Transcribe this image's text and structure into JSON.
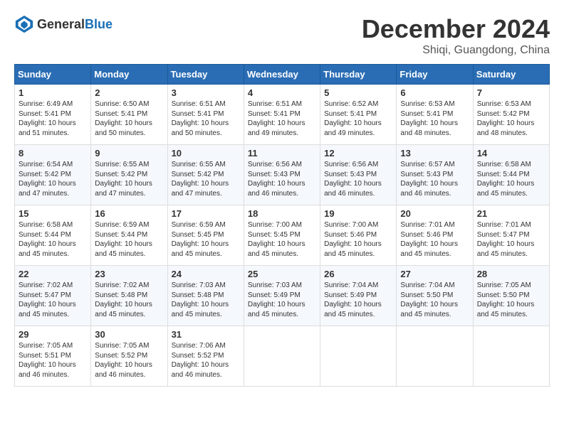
{
  "logo": {
    "text_general": "General",
    "text_blue": "Blue"
  },
  "title": {
    "month": "December 2024",
    "location": "Shiqi, Guangdong, China"
  },
  "calendar": {
    "headers": [
      "Sunday",
      "Monday",
      "Tuesday",
      "Wednesday",
      "Thursday",
      "Friday",
      "Saturday"
    ],
    "weeks": [
      [
        null,
        {
          "day": "2",
          "info": "Sunrise: 6:50 AM\nSunset: 5:41 PM\nDaylight: 10 hours and 50 minutes."
        },
        {
          "day": "3",
          "info": "Sunrise: 6:51 AM\nSunset: 5:41 PM\nDaylight: 10 hours and 50 minutes."
        },
        {
          "day": "4",
          "info": "Sunrise: 6:51 AM\nSunset: 5:41 PM\nDaylight: 10 hours and 49 minutes."
        },
        {
          "day": "5",
          "info": "Sunrise: 6:52 AM\nSunset: 5:41 PM\nDaylight: 10 hours and 49 minutes."
        },
        {
          "day": "6",
          "info": "Sunrise: 6:53 AM\nSunset: 5:41 PM\nDaylight: 10 hours and 48 minutes."
        },
        {
          "day": "7",
          "info": "Sunrise: 6:53 AM\nSunset: 5:42 PM\nDaylight: 10 hours and 48 minutes."
        }
      ],
      [
        {
          "day": "1",
          "info": "Sunrise: 6:49 AM\nSunset: 5:41 PM\nDaylight: 10 hours and 51 minutes."
        },
        {
          "day": "9",
          "info": "Sunrise: 6:55 AM\nSunset: 5:42 PM\nDaylight: 10 hours and 47 minutes."
        },
        {
          "day": "10",
          "info": "Sunrise: 6:55 AM\nSunset: 5:42 PM\nDaylight: 10 hours and 47 minutes."
        },
        {
          "day": "11",
          "info": "Sunrise: 6:56 AM\nSunset: 5:43 PM\nDaylight: 10 hours and 46 minutes."
        },
        {
          "day": "12",
          "info": "Sunrise: 6:56 AM\nSunset: 5:43 PM\nDaylight: 10 hours and 46 minutes."
        },
        {
          "day": "13",
          "info": "Sunrise: 6:57 AM\nSunset: 5:43 PM\nDaylight: 10 hours and 46 minutes."
        },
        {
          "day": "14",
          "info": "Sunrise: 6:58 AM\nSunset: 5:44 PM\nDaylight: 10 hours and 45 minutes."
        }
      ],
      [
        {
          "day": "8",
          "info": "Sunrise: 6:54 AM\nSunset: 5:42 PM\nDaylight: 10 hours and 47 minutes."
        },
        {
          "day": "16",
          "info": "Sunrise: 6:59 AM\nSunset: 5:44 PM\nDaylight: 10 hours and 45 minutes."
        },
        {
          "day": "17",
          "info": "Sunrise: 6:59 AM\nSunset: 5:45 PM\nDaylight: 10 hours and 45 minutes."
        },
        {
          "day": "18",
          "info": "Sunrise: 7:00 AM\nSunset: 5:45 PM\nDaylight: 10 hours and 45 minutes."
        },
        {
          "day": "19",
          "info": "Sunrise: 7:00 AM\nSunset: 5:46 PM\nDaylight: 10 hours and 45 minutes."
        },
        {
          "day": "20",
          "info": "Sunrise: 7:01 AM\nSunset: 5:46 PM\nDaylight: 10 hours and 45 minutes."
        },
        {
          "day": "21",
          "info": "Sunrise: 7:01 AM\nSunset: 5:47 PM\nDaylight: 10 hours and 45 minutes."
        }
      ],
      [
        {
          "day": "15",
          "info": "Sunrise: 6:58 AM\nSunset: 5:44 PM\nDaylight: 10 hours and 45 minutes."
        },
        {
          "day": "23",
          "info": "Sunrise: 7:02 AM\nSunset: 5:48 PM\nDaylight: 10 hours and 45 minutes."
        },
        {
          "day": "24",
          "info": "Sunrise: 7:03 AM\nSunset: 5:48 PM\nDaylight: 10 hours and 45 minutes."
        },
        {
          "day": "25",
          "info": "Sunrise: 7:03 AM\nSunset: 5:49 PM\nDaylight: 10 hours and 45 minutes."
        },
        {
          "day": "26",
          "info": "Sunrise: 7:04 AM\nSunset: 5:49 PM\nDaylight: 10 hours and 45 minutes."
        },
        {
          "day": "27",
          "info": "Sunrise: 7:04 AM\nSunset: 5:50 PM\nDaylight: 10 hours and 45 minutes."
        },
        {
          "day": "28",
          "info": "Sunrise: 7:05 AM\nSunset: 5:50 PM\nDaylight: 10 hours and 45 minutes."
        }
      ],
      [
        {
          "day": "22",
          "info": "Sunrise: 7:02 AM\nSunset: 5:47 PM\nDaylight: 10 hours and 45 minutes."
        },
        {
          "day": "30",
          "info": "Sunrise: 7:05 AM\nSunset: 5:52 PM\nDaylight: 10 hours and 46 minutes."
        },
        {
          "day": "31",
          "info": "Sunrise: 7:06 AM\nSunset: 5:52 PM\nDaylight: 10 hours and 46 minutes."
        },
        null,
        null,
        null,
        null
      ],
      [
        {
          "day": "29",
          "info": "Sunrise: 7:05 AM\nSunset: 5:51 PM\nDaylight: 10 hours and 46 minutes."
        },
        null,
        null,
        null,
        null,
        null,
        null
      ]
    ]
  }
}
